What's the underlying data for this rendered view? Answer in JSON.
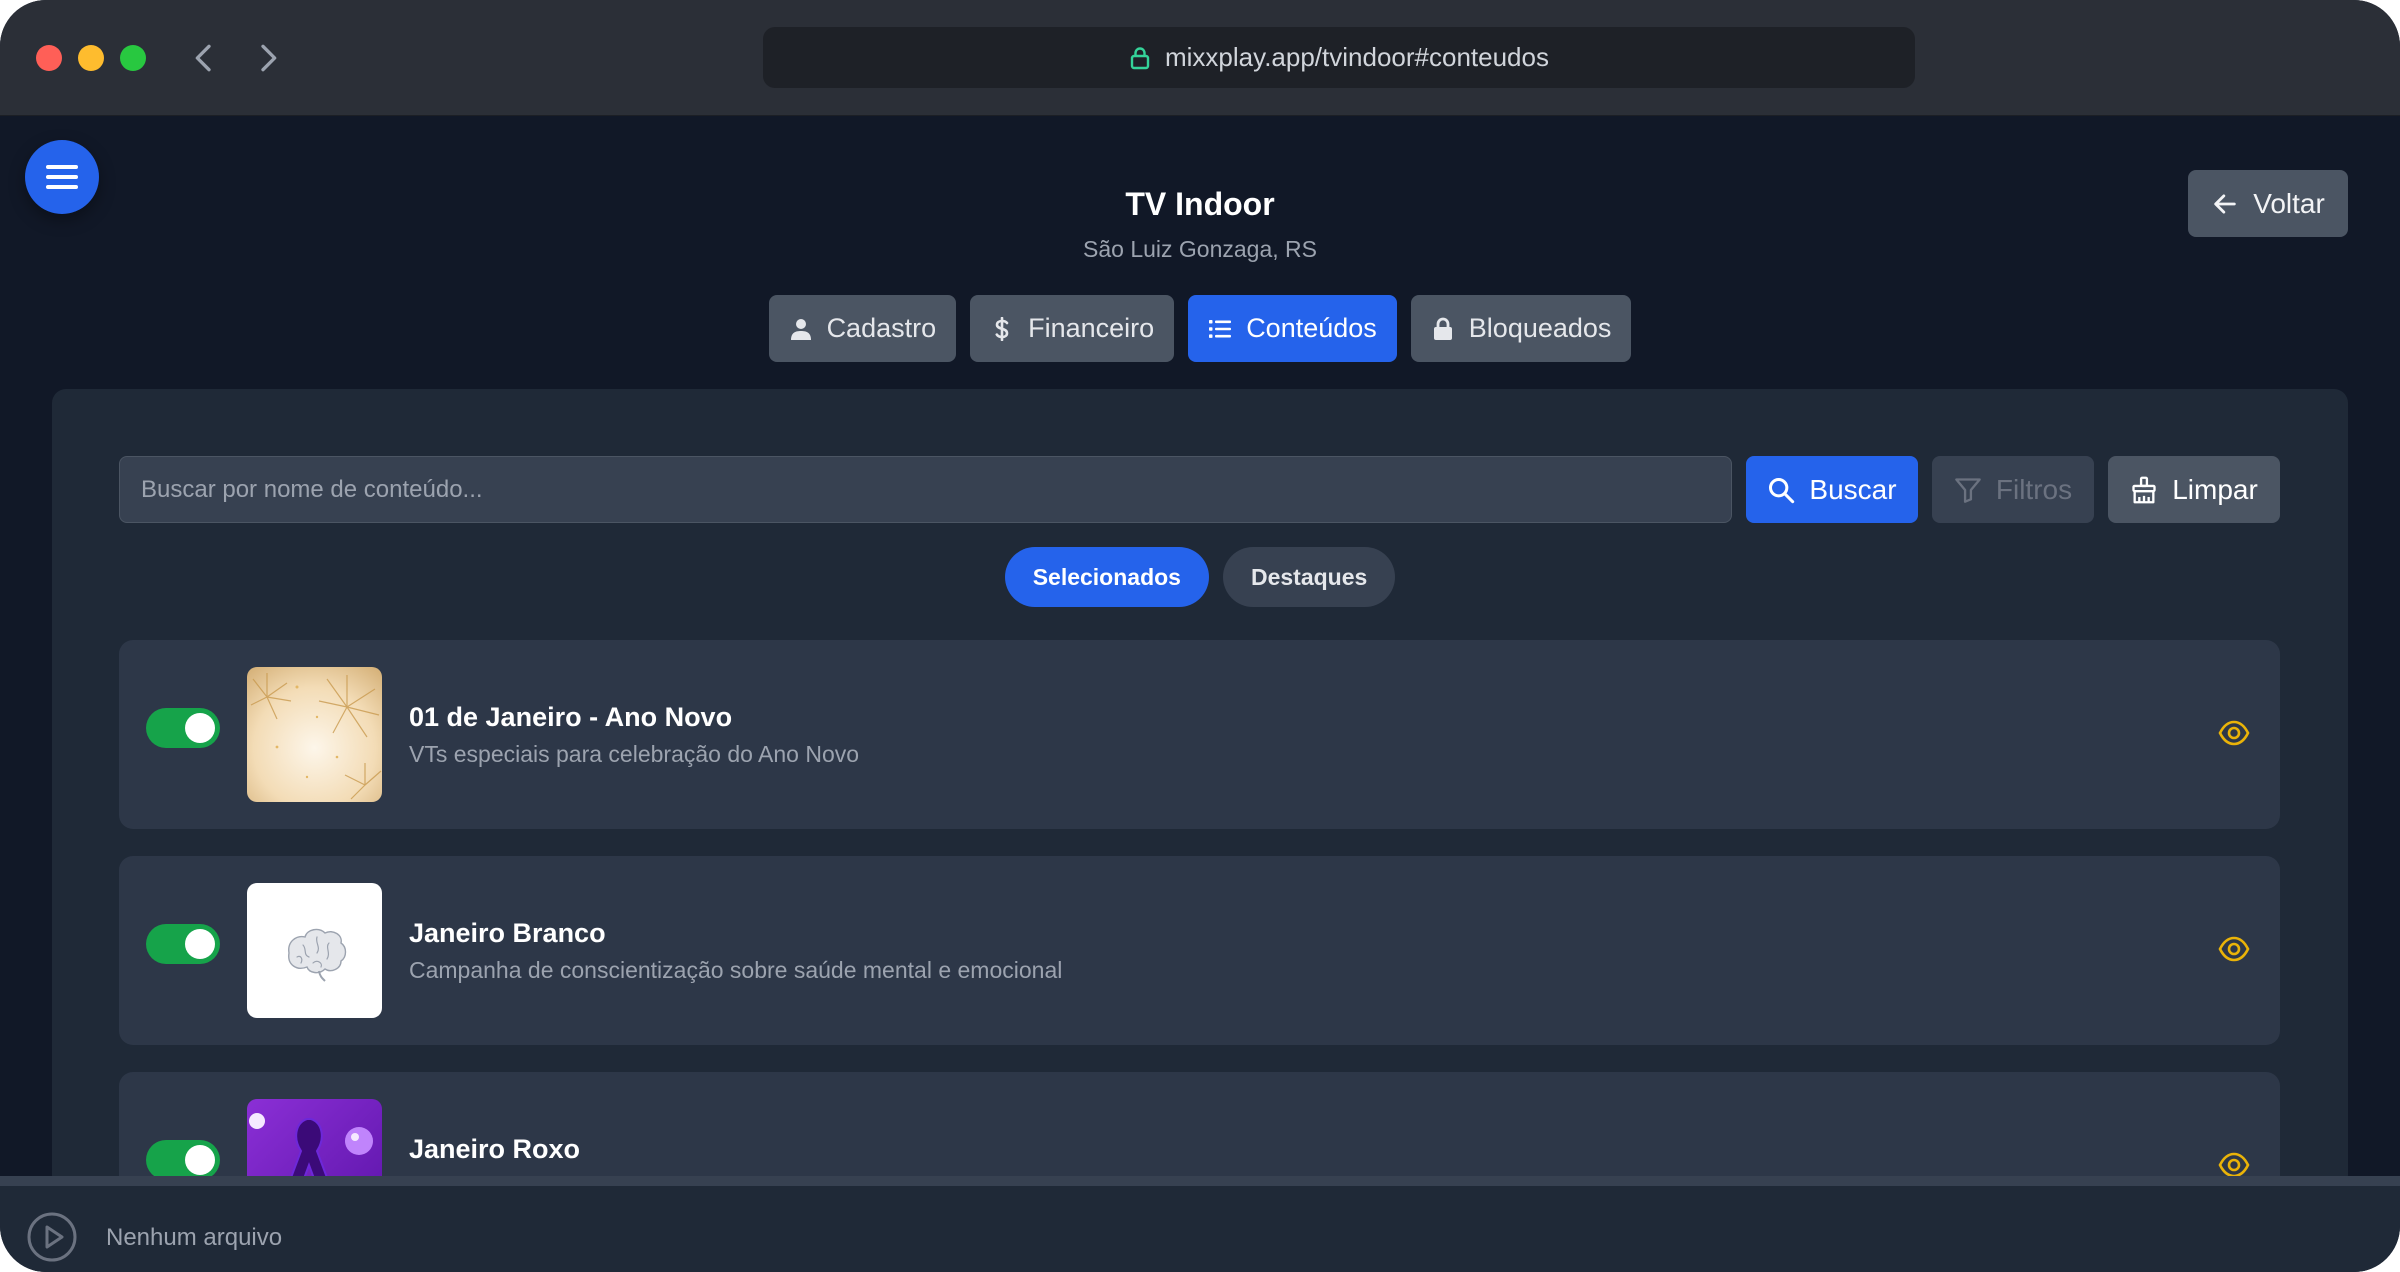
{
  "browser": {
    "url": "mixxplay.app/tvindoor#conteudos"
  },
  "header": {
    "title": "TV Indoor",
    "subtitle": "São Luiz Gonzaga, RS",
    "back_label": "Voltar"
  },
  "tabs": [
    {
      "label": "Cadastro",
      "icon": "user-icon",
      "active": false
    },
    {
      "label": "Financeiro",
      "icon": "dollar-icon",
      "active": false
    },
    {
      "label": "Conteúdos",
      "icon": "list-icon",
      "active": true
    },
    {
      "label": "Bloqueados",
      "icon": "lock-icon",
      "active": false
    }
  ],
  "search": {
    "placeholder": "Buscar por nome de conteúdo...",
    "value": "",
    "search_label": "Buscar",
    "filters_label": "Filtros",
    "clear_label": "Limpar"
  },
  "subtabs": [
    {
      "label": "Selecionados",
      "active": true
    },
    {
      "label": "Destaques",
      "active": false
    }
  ],
  "contents": [
    {
      "title": "01 de Janeiro - Ano Novo",
      "description": "VTs especiais para celebração do Ano Novo",
      "enabled": true,
      "thumbnail": "fireworks-image"
    },
    {
      "title": "Janeiro Branco",
      "description": "Campanha de conscientização sobre saúde mental e emocional",
      "enabled": true,
      "thumbnail": "brain-image"
    },
    {
      "title": "Janeiro Roxo",
      "description": "",
      "enabled": true,
      "thumbnail": "purple-ribbon-image"
    }
  ],
  "player": {
    "status": "Nenhum arquivo"
  },
  "colors": {
    "accent": "#2563eb",
    "toggle_on": "#16a34a",
    "eye": "#eab308",
    "background": "#111827",
    "panel": "#1f2937"
  }
}
